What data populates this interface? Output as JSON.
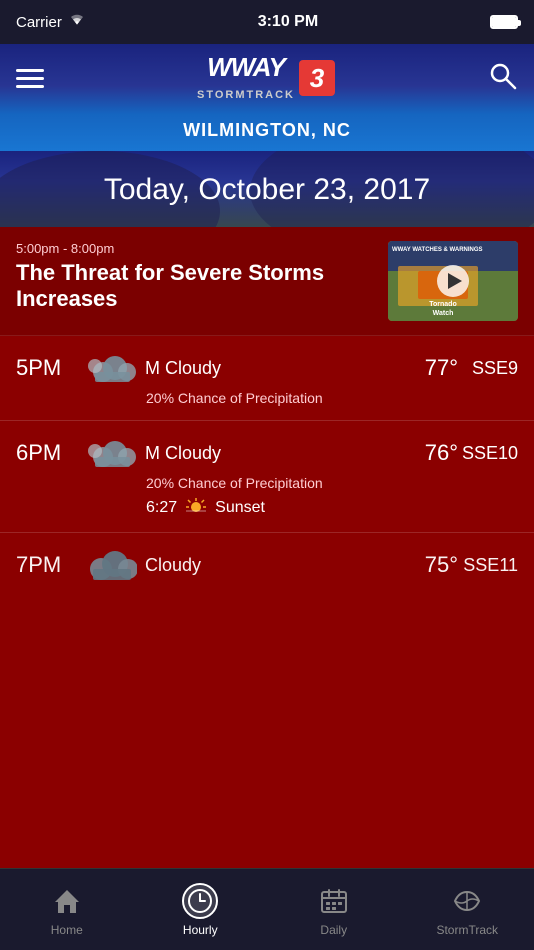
{
  "statusBar": {
    "carrier": "Carrier",
    "time": "3:10 PM"
  },
  "header": {
    "logoLine1": "WWAY",
    "logoLine2": "STORMTRACK",
    "logoBadge": "3",
    "city": "WILMINGTON, NC"
  },
  "dateBanner": {
    "dateText": "Today, October 23, 2017"
  },
  "alertCard": {
    "timeRange": "5:00pm - 8:00pm",
    "headline": "The Threat for Severe Storms Increases",
    "thumbLabel": "WWAY WATCHES & WARNINGS",
    "tornadoText": "Tornado Watch"
  },
  "hourlyRows": [
    {
      "hour": "5PM",
      "condition": "M Cloudy",
      "temp": "77°",
      "wind": "SSE9",
      "precip": "20% Chance of Precipitation",
      "sunset": null
    },
    {
      "hour": "6PM",
      "condition": "M Cloudy",
      "temp": "76°",
      "wind": "SSE10",
      "precip": "20% Chance of Precipitation",
      "sunset": {
        "time": "6:27",
        "label": "Sunset"
      }
    },
    {
      "hour": "7PM",
      "condition": "Cloudy",
      "temp": "75°",
      "wind": "SSE11",
      "precip": null,
      "sunset": null
    }
  ],
  "bottomNav": {
    "items": [
      {
        "id": "home",
        "label": "Home",
        "active": false
      },
      {
        "id": "hourly",
        "label": "Hourly",
        "active": true
      },
      {
        "id": "daily",
        "label": "Daily",
        "active": false
      },
      {
        "id": "stormtrack",
        "label": "StormTrack",
        "active": false
      }
    ]
  }
}
